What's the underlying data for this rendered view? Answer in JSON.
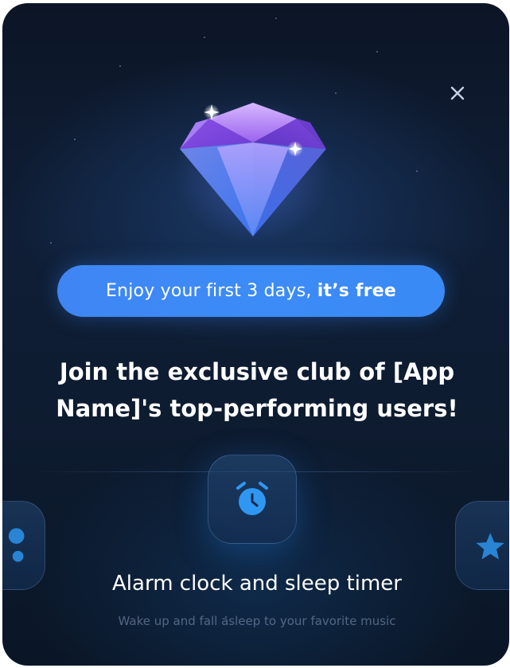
{
  "offer": {
    "prefix": "Enjoy your first 3 days, ",
    "highlight": "it’s free"
  },
  "headline": "Join the exclusive club of [App Name]'s top-performing users!",
  "feature": {
    "title": "Alarm clock and sleep timer",
    "description": "Wake up and fall asleep to your favorite music"
  },
  "icons": {
    "close": "close-icon",
    "hero": "diamond-icon",
    "feature_center": "alarm-clock-icon",
    "feature_left": "user-icon",
    "feature_right": "star-icon"
  },
  "colors": {
    "accent": "#3a8af6",
    "background": "#0e1c31",
    "text": "#ffffff",
    "muted_text": "#5c6b82"
  }
}
